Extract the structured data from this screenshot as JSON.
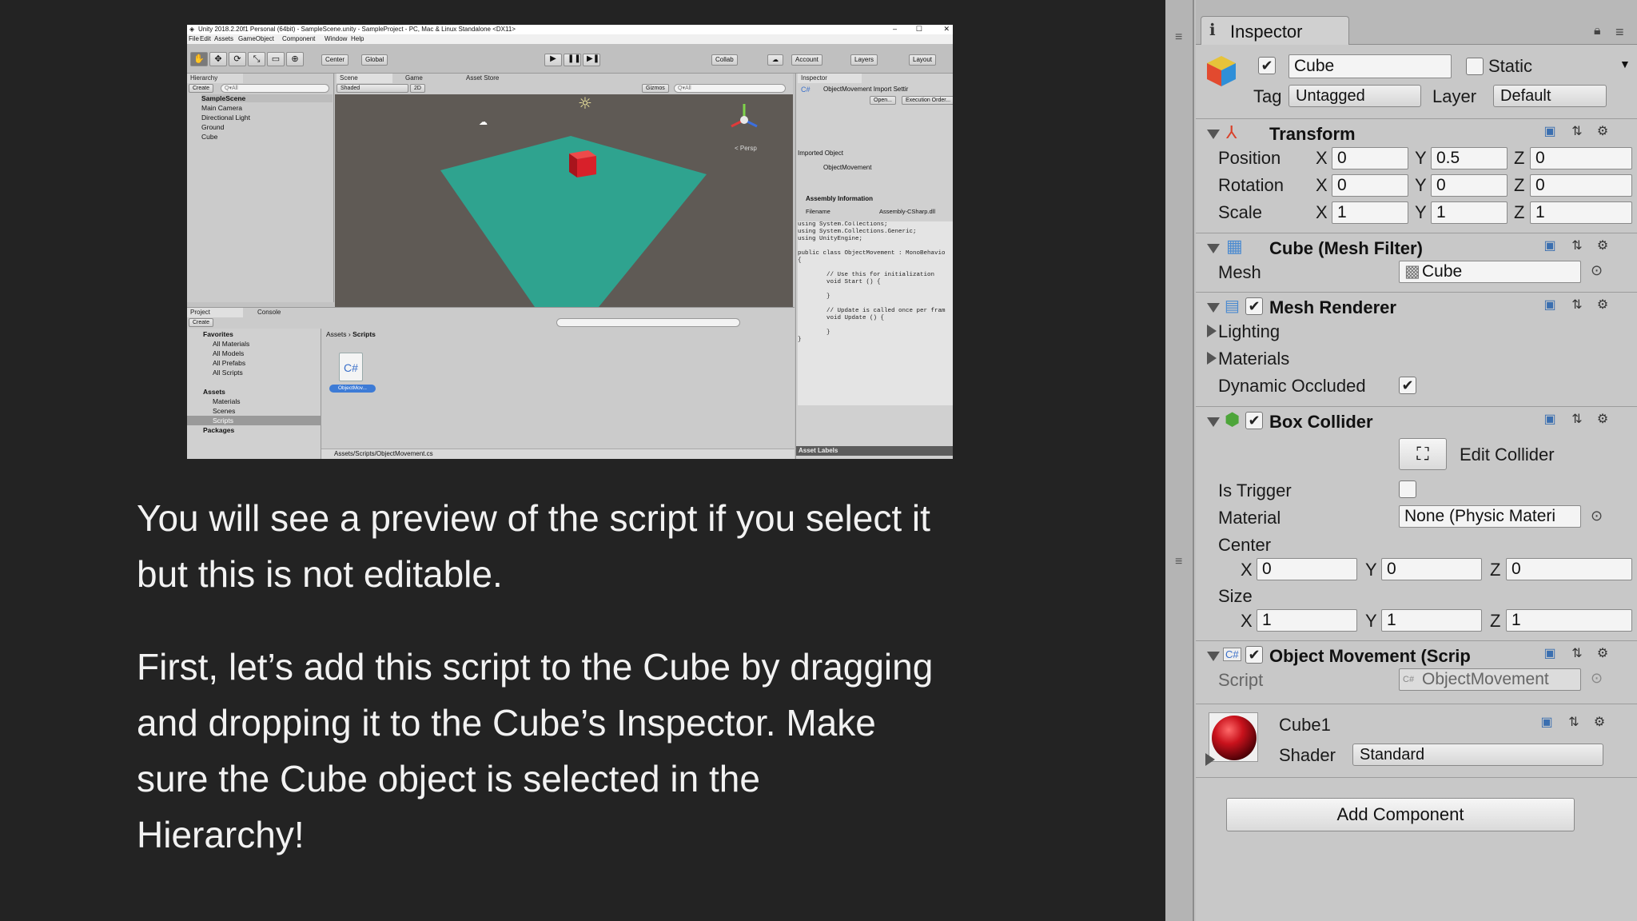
{
  "slide": {
    "paragraph1": "You will see a preview of the script if you select it but this is not editable.",
    "paragraph2": "First, let’s add this script to the Cube by dragging and dropping it to the Cube’s Inspector. Make sure the Cube object is selected in the Hierarchy!"
  },
  "unity_window": {
    "title": "Unity 2018.2.20f1 Personal (64bit) - SampleScene.unity - SampleProject - PC, Mac & Linux Standalone <DX11>",
    "menu": [
      "File",
      "Edit",
      "Assets",
      "GameObject",
      "Component",
      "Window",
      "Help"
    ],
    "toolbar": {
      "center": "Center",
      "global": "Global",
      "collab": "Collab",
      "account": "Account",
      "layers": "Layers",
      "layout": "Layout"
    },
    "hierarchy": {
      "tab": "Hierarchy",
      "create": "Create",
      "search_placeholder": "Q▾All",
      "scene": "SampleScene",
      "items": [
        "Main Camera",
        "Directional Light",
        "Ground",
        "Cube"
      ]
    },
    "scene_tabs": [
      "Scene",
      "Game",
      "Asset Store"
    ],
    "scene_toolbar": {
      "shading": "Shaded",
      "mode": "2D",
      "gizmos": "Gizmos",
      "search": "Q▾All"
    },
    "persp_label": "< Persp",
    "project": {
      "tabs": [
        "Project",
        "Console"
      ],
      "create": "Create",
      "favorites_label": "Favorites",
      "favorites": [
        "All Materials",
        "All Models",
        "All Prefabs",
        "All Scripts"
      ],
      "assets_label": "Assets",
      "assets": [
        "Materials",
        "Scenes",
        "Scripts"
      ],
      "packages_label": "Packages",
      "breadcrumb": [
        "Assets",
        "Scripts"
      ],
      "file_icon_text": "C#",
      "file_name": "ObjectMov...",
      "status_path": "Assets/Scripts/ObjectMovement.cs"
    },
    "mini_inspector": {
      "tab": "Inspector",
      "header": "ObjectMovement Import Settir",
      "open_button": "Open...",
      "execution_button": "Execution Order...",
      "imported_object": "Imported Object",
      "object_name": "ObjectMovement",
      "assembly_info": "Assembly Information",
      "filename_label": "Filename",
      "filename_value": "Assembly-CSharp.dll",
      "code": "using System.Collections;\nusing System.Collections.Generic;\nusing UnityEngine;\n\npublic class ObjectMovement : MonoBehavio\n{\n\n        // Use this for initialization\n        void Start () {\n\n        }\n\n        // Update is called once per fram\n        void Update () {\n\n        }\n}",
      "asset_labels": "Asset Labels"
    }
  },
  "inspector": {
    "tab": "Inspector",
    "object": {
      "name": "Cube",
      "static_label": "Static",
      "tag_label": "Tag",
      "tag_value": "Untagged",
      "layer_label": "Layer",
      "layer_value": "Default"
    },
    "transform": {
      "title": "Transform",
      "position_label": "Position",
      "position": {
        "x": "0",
        "y": "0.5",
        "z": "0"
      },
      "rotation_label": "Rotation",
      "rotation": {
        "x": "0",
        "y": "0",
        "z": "0"
      },
      "scale_label": "Scale",
      "scale": {
        "x": "1",
        "y": "1",
        "z": "1"
      }
    },
    "mesh_filter": {
      "title": "Cube (Mesh Filter)",
      "mesh_label": "Mesh",
      "mesh_value": "Cube"
    },
    "mesh_renderer": {
      "title": "Mesh Renderer",
      "lighting": "Lighting",
      "materials": "Materials",
      "dynamic_occluded": "Dynamic Occluded"
    },
    "box_collider": {
      "title": "Box Collider",
      "edit_collider": "Edit Collider",
      "is_trigger": "Is Trigger",
      "material_label": "Material",
      "material_value": "None (Physic Materi",
      "center_label": "Center",
      "center": {
        "x": "0",
        "y": "0",
        "z": "0"
      },
      "size_label": "Size",
      "size": {
        "x": "1",
        "y": "1",
        "z": "1"
      }
    },
    "object_movement": {
      "title": "Object Movement (Scrip",
      "script_label": "Script",
      "script_value": "ObjectMovement"
    },
    "material": {
      "name": "Cube1",
      "shader_label": "Shader",
      "shader_value": "Standard"
    },
    "add_component": "Add Component",
    "axis": {
      "x": "X",
      "y": "Y",
      "z": "Z"
    }
  },
  "colors": {
    "slide_bg": "#232323",
    "slide_text": "#f2f2f2",
    "ground": "#2fa38f",
    "cube": "#d8202a",
    "sky": "#5f5a55",
    "selection": "#3d7bd6"
  }
}
